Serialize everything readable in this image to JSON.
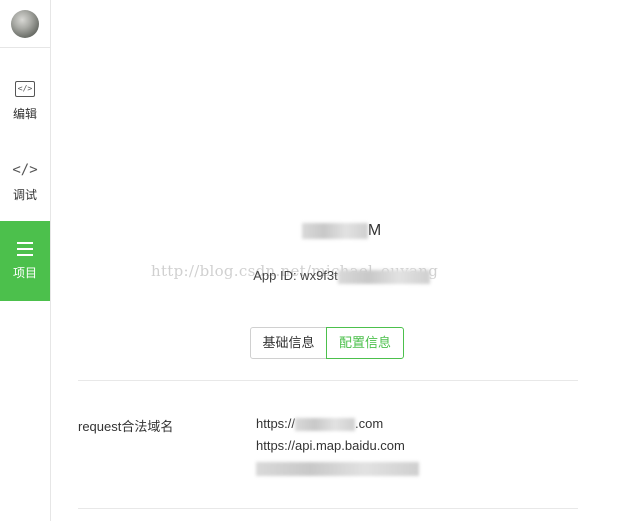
{
  "sidebar": {
    "items": [
      {
        "label": "编辑",
        "icon": "code-box-icon"
      },
      {
        "label": "调试",
        "icon": "code-icon"
      },
      {
        "label": "项目",
        "icon": "menu-icon",
        "active": true
      }
    ]
  },
  "project": {
    "name_visible": "M",
    "app_id_label": "App ID: wx9f3t"
  },
  "watermark": "http://blog.csdn.net/michael_ouyang",
  "tabs": {
    "basic": "基础信息",
    "config": "配置信息"
  },
  "config": {
    "request_label": "request合法域名",
    "domain_1_prefix": "https://",
    "domain_1_suffix": ".com",
    "domain_2": "https://api.map.baidu.com"
  },
  "colors": {
    "accent": "#4cc04c"
  }
}
